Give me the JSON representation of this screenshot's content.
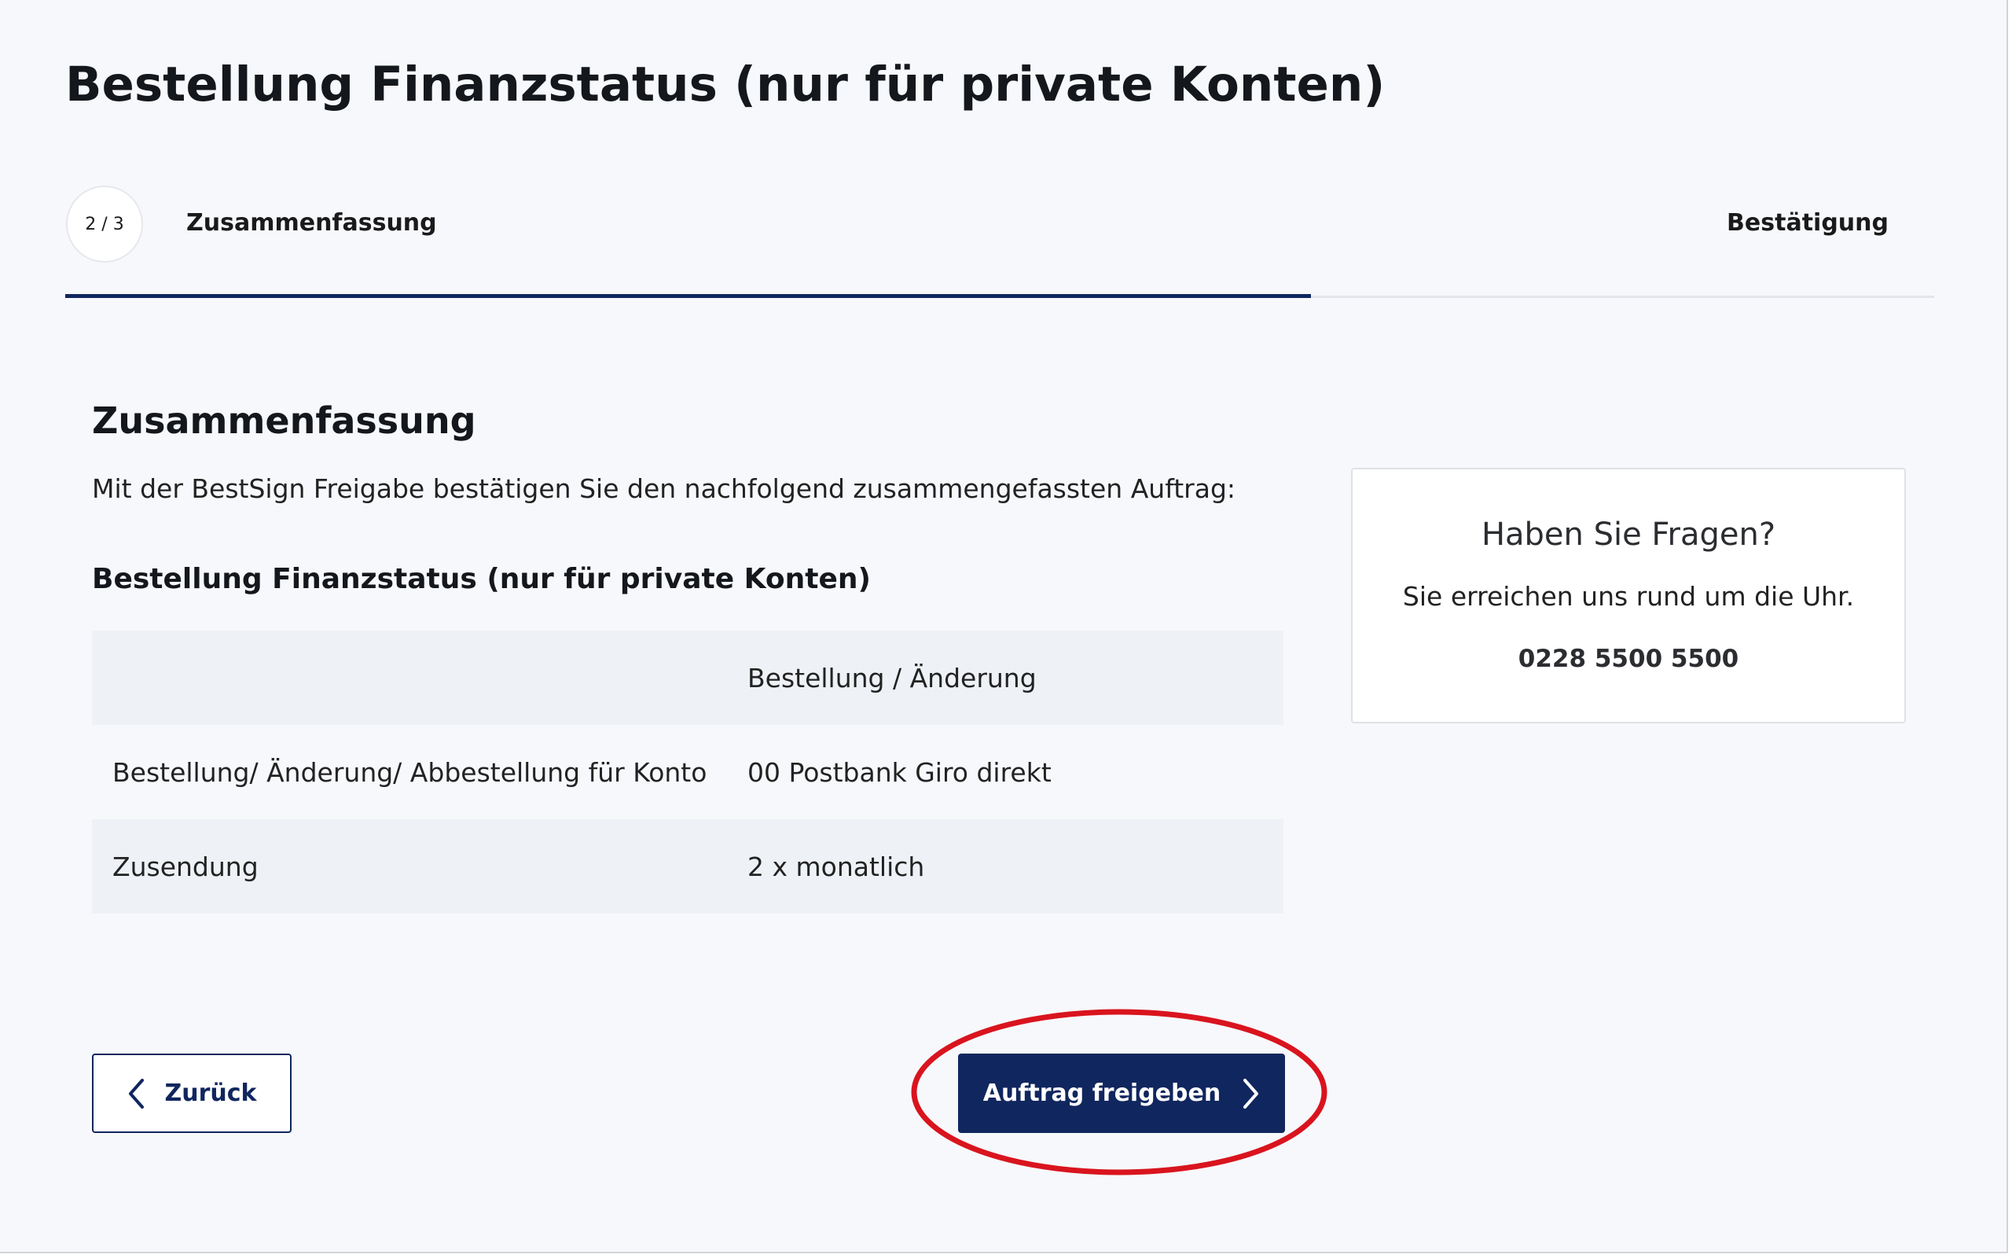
{
  "page": {
    "title": "Bestellung Finanzstatus (nur für private Konten)"
  },
  "stepper": {
    "step_counter": "2 / 3",
    "current_step_label": "Zusammenfassung",
    "next_step_label": "Bestätigung",
    "progress_steps_done": 2,
    "progress_steps_total": 3
  },
  "summary": {
    "heading": "Zusammenfassung",
    "intro": "Mit der BestSign Freigabe bestätigen Sie den nachfolgend zusammengefassten Auftrag:",
    "order_title": "Bestellung Finanzstatus (nur für private Konten)",
    "table": {
      "header": [
        "",
        "Bestellung / Änderung"
      ],
      "rows": [
        [
          "Bestellung/ Änderung/ Abbestellung für Konto",
          "00 Postbank Giro direkt"
        ],
        [
          "Zusendung",
          "2 x monatlich"
        ]
      ]
    }
  },
  "help": {
    "title": "Haben Sie Fragen?",
    "text": "Sie erreichen uns rund um die Uhr.",
    "phone": "0228 5500 5500"
  },
  "actions": {
    "back_label": "Zurück",
    "back_icon": "chevron-left-icon",
    "submit_label": "Auftrag freigeben",
    "submit_icon": "chevron-right-icon"
  },
  "colors": {
    "brand_navy": "#10265e",
    "page_background": "#f7f8fb",
    "table_shade": "#eef1f6",
    "annotation_red": "#d9141e"
  }
}
